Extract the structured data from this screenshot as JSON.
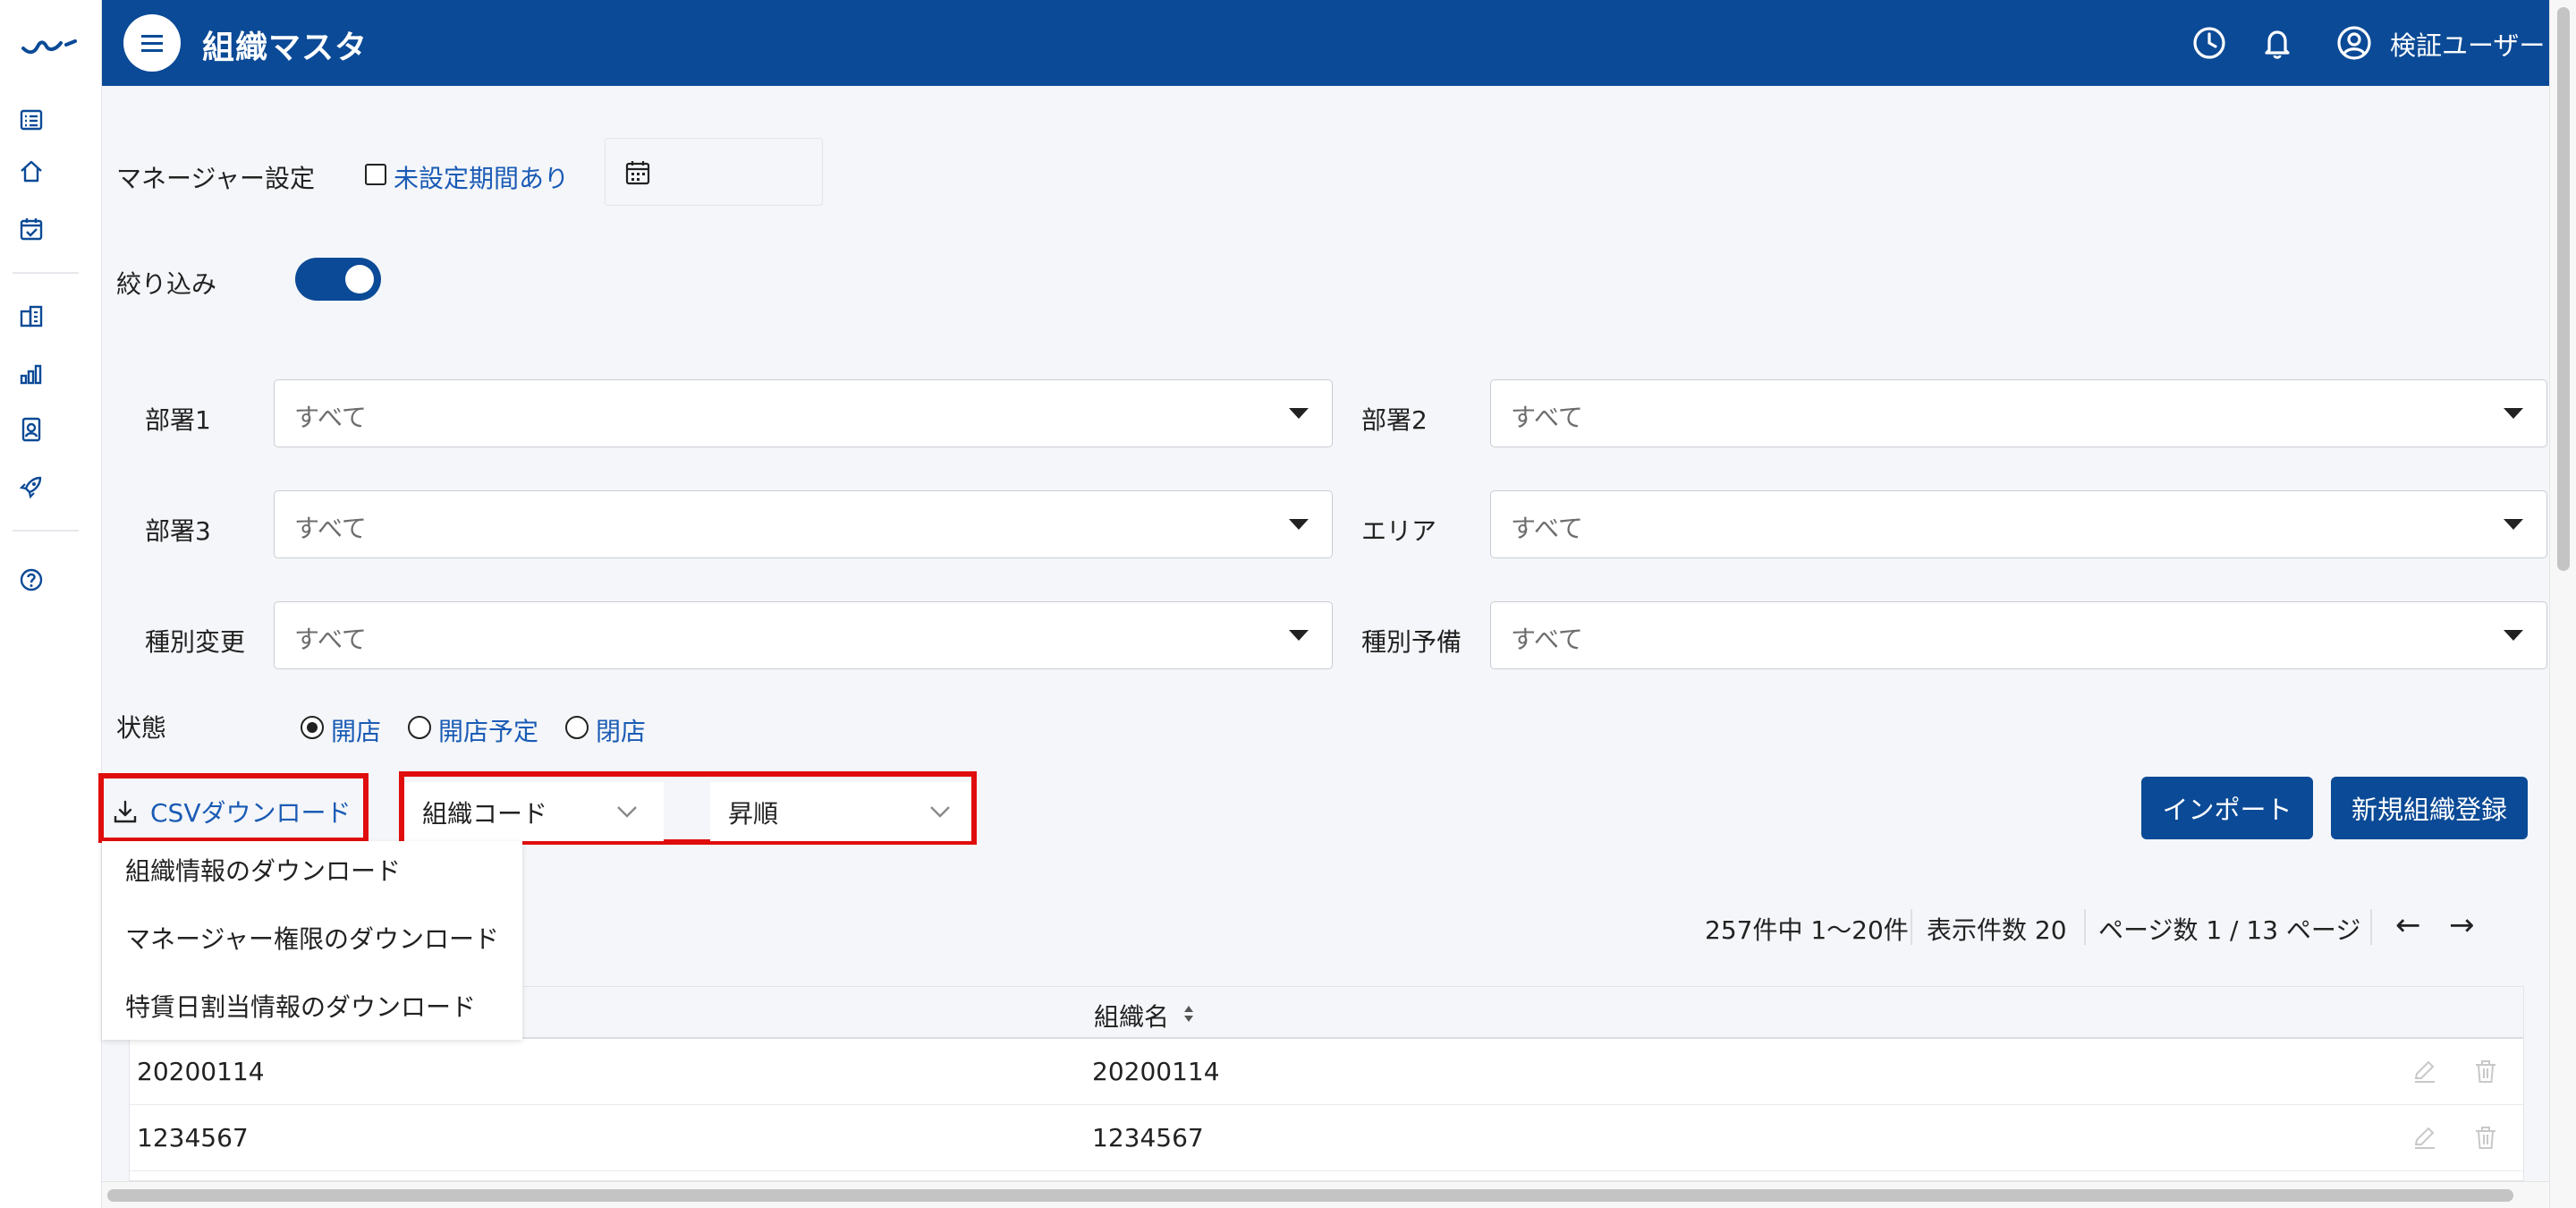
{
  "header": {
    "title": "組織マスタ",
    "user_name": "検証ユーザー"
  },
  "colors": {
    "brand": "#0b4a96",
    "link": "#1a5bb5",
    "highlight": "#e00d0d"
  },
  "sidebar": {
    "icons": [
      "logo-icon",
      "list-icon",
      "home-icon",
      "calendar-check-icon",
      "building-icon",
      "bar-chart-icon",
      "id-badge-icon",
      "rocket-icon",
      "help-icon"
    ]
  },
  "manager": {
    "label": "マネージャー設定",
    "checkbox_label": "未設定期間あり",
    "checked": false
  },
  "filter": {
    "label": "絞り込み",
    "enabled": true,
    "fields": [
      {
        "label": "部署1",
        "value": "すべて"
      },
      {
        "label": "部署2",
        "value": "すべて"
      },
      {
        "label": "部署3",
        "value": "すべて"
      },
      {
        "label": "エリア",
        "value": "すべて"
      },
      {
        "label": "種別変更",
        "value": "すべて"
      },
      {
        "label": "種別予備",
        "value": "すべて"
      }
    ]
  },
  "status": {
    "label": "状態",
    "options": [
      "開店",
      "開店予定",
      "閉店"
    ],
    "selected": "開店"
  },
  "toolbar": {
    "csv_label": "CSVダウンロード",
    "sort_field": "組織コード",
    "sort_order": "昇順",
    "import_label": "インポート",
    "new_label": "新規組織登録"
  },
  "csv_menu": {
    "items": [
      "組織情報のダウンロード",
      "マネージャー権限のダウンロード",
      "特賃日割当情報のダウンロード"
    ]
  },
  "pagination": {
    "summary": "257件中 1〜20件",
    "per_page": "表示件数 20",
    "pages": "ページ数 1 / 13 ページ",
    "prev": "←",
    "next": "→"
  },
  "table": {
    "columns": [
      "組織名"
    ],
    "rows": [
      {
        "code": "20200114",
        "name": "20200114"
      },
      {
        "code": "1234567",
        "name": "1234567"
      }
    ]
  }
}
